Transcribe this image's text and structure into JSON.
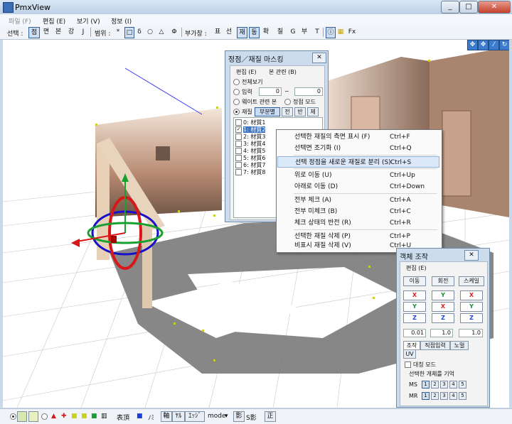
{
  "window": {
    "title": "PmxView",
    "min": "_",
    "max": "□",
    "close": "✕"
  },
  "menu": [
    "파일 (F)",
    "편집 (E)",
    "보기 (V)",
    "정보 (I)"
  ],
  "toolbar": {
    "select_label": "선택 :",
    "select_modes": [
      "점",
      "면",
      "본",
      "강",
      "J"
    ],
    "range_label": "범위 :",
    "range_modes": [
      "*",
      "□",
      "δ",
      "○",
      "△",
      "Φ"
    ],
    "window_label": "부가창 :",
    "windows": [
      "표",
      "선",
      "재",
      "동",
      "확",
      "칠",
      "G",
      "부",
      "T"
    ],
    "fx": "Fx"
  },
  "viewport_icons": [
    "move-icon",
    "move-all-icon",
    "wand-icon",
    "rotate-icon"
  ],
  "mask_panel": {
    "title": "정점／재질 마스킹",
    "close": "✕",
    "menu": [
      "편집 (E)",
      "본 관련 (B)"
    ],
    "options": {
      "all": "전체보기",
      "input": "입력",
      "input_from": "0",
      "tilde": "~",
      "input_to": "0",
      "weight": "웨이트 관련 본",
      "vertex_mode": "정점 모드",
      "material": "재질"
    },
    "buttons": [
      "부분별",
      "전",
      "반",
      "제"
    ],
    "materials": [
      {
        "label": "0: 材質1",
        "checked": false
      },
      {
        "label": "1: 材質2",
        "checked": true
      },
      {
        "label": "2: 材質3",
        "checked": false
      },
      {
        "label": "3: 材質4",
        "checked": false
      },
      {
        "label": "4: 材質5",
        "checked": false
      },
      {
        "label": "5: 材質6",
        "checked": false
      },
      {
        "label": "6: 材質7",
        "checked": false
      },
      {
        "label": "7: 材質8",
        "checked": false
      }
    ]
  },
  "context_menu": {
    "items": [
      {
        "label": "선택한 재질의 측면 표시 (F)",
        "shortcut": "Ctrl+F"
      },
      {
        "label": "선택면 조기화 (I)",
        "shortcut": "Ctrl+Q"
      },
      {
        "label": "선택 정점을 새로운 재질로 분리 (S)",
        "shortcut": "Ctrl+S"
      },
      {
        "label": "위로 이동 (U)",
        "shortcut": "Ctrl+Up"
      },
      {
        "label": "아래로 이동 (D)",
        "shortcut": "Ctrl+Down"
      },
      {
        "label": "전부 체크 (A)",
        "shortcut": "Ctrl+A"
      },
      {
        "label": "전부 미체크 (B)",
        "shortcut": "Ctrl+C"
      },
      {
        "label": "체크 상태의 반전 (R)",
        "shortcut": "Ctrl+R"
      },
      {
        "label": "선택한 재질 삭제 (P)",
        "shortcut": "Ctrl+P"
      },
      {
        "label": "비표시 재질 삭제 (V)",
        "shortcut": "Ctrl+U"
      }
    ]
  },
  "object_panel": {
    "title": "객체 조작",
    "close": "✕",
    "menu": "편집 (E)",
    "modes": [
      "이동",
      "회전",
      "스케일"
    ],
    "axes": [
      [
        "X",
        "Y",
        "X"
      ],
      [
        "Y",
        "X",
        "Y"
      ],
      [
        "Z",
        "Z",
        "Z"
      ]
    ],
    "axis_colors": {
      "X": "#e02020",
      "Y": "#109030",
      "Z": "#1a3fd8"
    },
    "values": [
      "0.01",
      "1.0",
      "1.0"
    ],
    "tabs": [
      "조작",
      "직접입력",
      "노멀",
      "UV"
    ],
    "symmetric": "대칭 모드",
    "remember": "선택한 개체를 기억",
    "ms_label": "MS",
    "mr_label": "MR",
    "slots": [
      "1",
      "2",
      "3",
      "4",
      "5"
    ]
  },
  "statusbar": {
    "labels": [
      "表頂",
      "ﾉﾐ",
      "軸",
      "ﾔﾙ",
      "ｴｯｼﾞ",
      "mode",
      "影",
      "S影",
      "正"
    ]
  }
}
